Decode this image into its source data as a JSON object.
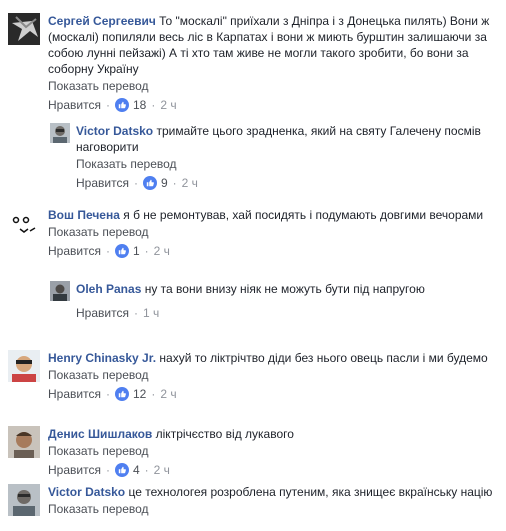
{
  "labels": {
    "show_translation": "Показать перевод",
    "like": "Нравится",
    "separator": "·"
  },
  "comments": [
    {
      "author": "Сергей Сергеевич",
      "text": "То \"москалі\" приїхали з Дніпра і з Донецька пилять) Вони ж (москалі) попиляли весь ліс в Карпатах і вони ж миють бурштин залишаючи за собою лунні пейзажі) А ті хто там живе не могли такого зробити, бо вони за соборну Україну",
      "likes": "18",
      "time": "2 ч",
      "reply": {
        "author": "Victor Datsko",
        "text": "тримайте цього зрадненка, який на святу Галечену посмів наговорити",
        "likes": "9",
        "time": "2 ч"
      }
    },
    {
      "author": "Вош Печена",
      "text": "я б не ремонтував, хай посидять і подумають довгими вечорами",
      "likes": "1",
      "time": "2 ч",
      "reply": {
        "author": "Oleh Panas",
        "text": "ну та вони внизу ніяк не можуть бути під напругою",
        "time": "1 ч"
      }
    },
    {
      "author": "Henry Chinasky Jr.",
      "text": "нахуй то ліктрічтво діди без нього овець пасли і ми будемо",
      "likes": "12",
      "time": "2 ч"
    },
    {
      "author": "Денис Шишлаков",
      "text": "ліктрічєство від лукавого",
      "likes": "4",
      "time": "2 ч"
    },
    {
      "author": "Victor Datsko",
      "text": "це технологея розроблена путеним, яка знищеє вкраїнську націю"
    }
  ],
  "colors": {
    "author": "#365899",
    "like_badge": "#4f7ff0",
    "meta": "#90949c"
  }
}
